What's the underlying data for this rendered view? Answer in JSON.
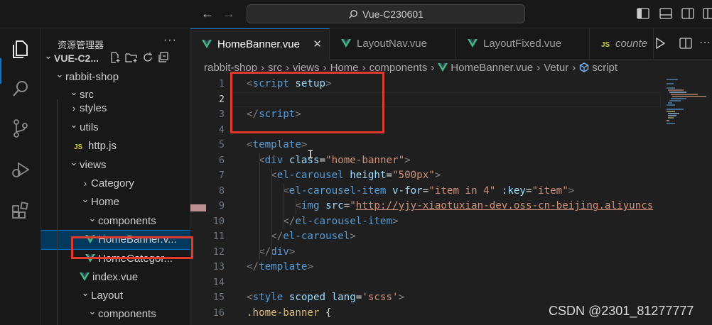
{
  "titlebar": {
    "search_text": "Vue-C230601"
  },
  "activity_bar": {
    "items": [
      "files-icon",
      "search-icon",
      "source-control-icon",
      "run-debug-icon",
      "extensions-icon"
    ]
  },
  "sidebar": {
    "title": "资源管理器",
    "more": "···",
    "rows": [
      {
        "label": "VUE-C2...",
        "indent": 0,
        "kind": "root",
        "chevron": "v"
      },
      {
        "label": "rabbit-shop",
        "indent": 1,
        "kind": "folder",
        "chevron": "v"
      },
      {
        "label": "src",
        "indent": 2,
        "kind": "folder",
        "chevron": "v"
      },
      {
        "label": "styles",
        "indent": 3,
        "kind": "folder",
        "chevron": ">"
      },
      {
        "label": "utils",
        "indent": 3,
        "kind": "folder",
        "chevron": "v"
      },
      {
        "label": "http.js",
        "indent": 4,
        "kind": "js",
        "chevron": ""
      },
      {
        "label": "views",
        "indent": 3,
        "kind": "folder",
        "chevron": "v"
      },
      {
        "label": "Category",
        "indent": 4,
        "kind": "folder",
        "chevron": ">"
      },
      {
        "label": "Home",
        "indent": 4,
        "kind": "folder",
        "chevron": "v"
      },
      {
        "label": "components",
        "indent": 5,
        "kind": "folder",
        "chevron": "v"
      },
      {
        "label": "HomeBanner.v...",
        "indent": 6,
        "kind": "vue",
        "chevron": "",
        "selected": true
      },
      {
        "label": "HomeCategor...",
        "indent": 6,
        "kind": "vue",
        "chevron": ""
      },
      {
        "label": "index.vue",
        "indent": 5,
        "kind": "vue",
        "chevron": ""
      },
      {
        "label": "Layout",
        "indent": 4,
        "kind": "folder",
        "chevron": "v"
      },
      {
        "label": "components",
        "indent": 5,
        "kind": "folder",
        "chevron": "v"
      }
    ]
  },
  "tabs": [
    {
      "label": "HomeBanner.vue",
      "kind": "vue",
      "active": true,
      "close": "✕"
    },
    {
      "label": "LayoutNav.vue",
      "kind": "vue",
      "active": false
    },
    {
      "label": "LayoutFixed.vue",
      "kind": "vue",
      "active": false
    },
    {
      "label": "counte",
      "kind": "js",
      "active": false
    }
  ],
  "breadcrumb": [
    "rabbit-shop",
    "src",
    "views",
    "Home",
    "components",
    "HomeBanner.vue",
    "Vetur",
    "script"
  ],
  "code": {
    "current_line": 2,
    "lines": [
      [
        [
          "t-p",
          "<"
        ],
        [
          "t-tag",
          "script "
        ],
        [
          "t-attr",
          "setup"
        ],
        [
          "t-p",
          ">"
        ]
      ],
      [],
      [
        [
          "t-p",
          "</"
        ],
        [
          "t-tag",
          "script"
        ],
        [
          "t-p",
          ">"
        ]
      ],
      [],
      [
        [
          "t-p",
          "<"
        ],
        [
          "t-tag",
          "template"
        ],
        [
          "t-p",
          ">"
        ]
      ],
      [
        [
          "t-punc",
          "  "
        ],
        [
          "t-p",
          "<"
        ],
        [
          "t-tag",
          "div "
        ],
        [
          "t-attr",
          "class"
        ],
        [
          "t-punc",
          "="
        ],
        [
          "t-str",
          "\"home-banner\""
        ],
        [
          "t-p",
          ">"
        ]
      ],
      [
        [
          "t-punc",
          "    "
        ],
        [
          "t-p",
          "<"
        ],
        [
          "t-tag",
          "el-carousel "
        ],
        [
          "t-attr",
          "height"
        ],
        [
          "t-punc",
          "="
        ],
        [
          "t-str",
          "\"500px\""
        ],
        [
          "t-p",
          ">"
        ]
      ],
      [
        [
          "t-punc",
          "      "
        ],
        [
          "t-p",
          "<"
        ],
        [
          "t-tag",
          "el-carousel-item "
        ],
        [
          "t-attr",
          "v-for"
        ],
        [
          "t-punc",
          "="
        ],
        [
          "t-str",
          "\"item in 4\" "
        ],
        [
          "t-attr",
          ":key"
        ],
        [
          "t-punc",
          "="
        ],
        [
          "t-str",
          "\"item\""
        ],
        [
          "t-p",
          ">"
        ]
      ],
      [
        [
          "t-punc",
          "        "
        ],
        [
          "t-p",
          "<"
        ],
        [
          "t-tag",
          "img "
        ],
        [
          "t-attr",
          "src"
        ],
        [
          "t-punc",
          "="
        ],
        [
          "t-str",
          "\""
        ],
        [
          "link",
          "http://yjy-xiaotuxian-dev.oss-cn-beijing.aliyuncs"
        ]
      ],
      [
        [
          "t-punc",
          "      "
        ],
        [
          "t-p",
          "</"
        ],
        [
          "t-tag",
          "el-carousel-item"
        ],
        [
          "t-p",
          ">"
        ]
      ],
      [
        [
          "t-punc",
          "    "
        ],
        [
          "t-p",
          "</"
        ],
        [
          "t-tag",
          "el-carousel"
        ],
        [
          "t-p",
          ">"
        ]
      ],
      [
        [
          "t-punc",
          "  "
        ],
        [
          "t-p",
          "</"
        ],
        [
          "t-tag",
          "div"
        ],
        [
          "t-p",
          ">"
        ]
      ],
      [
        [
          "t-p",
          "</"
        ],
        [
          "t-tag",
          "template"
        ],
        [
          "t-p",
          ">"
        ]
      ],
      [],
      [
        [
          "t-p",
          "<"
        ],
        [
          "t-tag",
          "style "
        ],
        [
          "t-attr",
          "scoped "
        ],
        [
          "t-attr",
          "lang"
        ],
        [
          "t-punc",
          "="
        ],
        [
          "t-str",
          "'scss'"
        ],
        [
          "t-p",
          ">"
        ]
      ],
      [
        [
          "t-sel",
          ".home-banner"
        ],
        [
          "t-punc",
          " {"
        ]
      ]
    ]
  },
  "watermark": "CSDN @2301_81277777",
  "colors": {
    "accent": "#0078d4",
    "annotation": "#e03a2c",
    "vue_green": "#41b883"
  }
}
